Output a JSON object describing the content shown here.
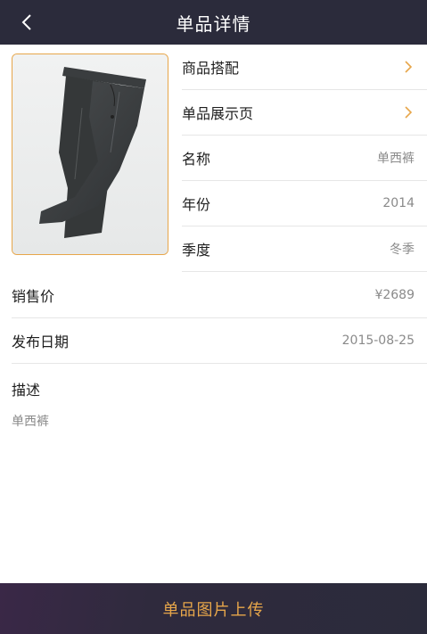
{
  "header": {
    "back_icon": "chevron-left-icon",
    "title": "单品详情"
  },
  "product": {
    "image_alt": "gray trousers photo"
  },
  "rows": [
    {
      "label": "商品搭配",
      "icon": "chevron-right-icon"
    },
    {
      "label": "单品展示页",
      "icon": "chevron-right-icon"
    },
    {
      "label": "名称",
      "value": "单西裤"
    },
    {
      "label": "年份",
      "value": "2014"
    },
    {
      "label": "季度",
      "value": "冬季"
    },
    {
      "label": "销售价",
      "value": "¥2689"
    },
    {
      "label": "发布日期",
      "value": "2015-08-25"
    }
  ],
  "description": {
    "label": "描述",
    "text": "单西裤"
  },
  "footer": {
    "upload_label": "单品图片上传"
  },
  "colors": {
    "header_bg": "#2b2b3b",
    "accent": "#e7a64a",
    "divider": "#e6e6e6"
  }
}
